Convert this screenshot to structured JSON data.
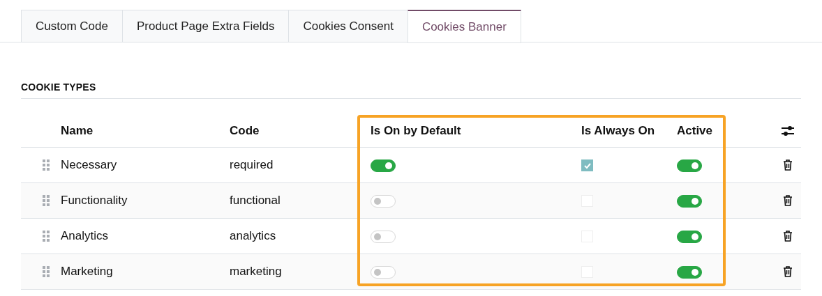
{
  "tabs": [
    {
      "label": "Custom Code",
      "selected": false
    },
    {
      "label": "Product Page Extra Fields",
      "selected": false
    },
    {
      "label": "Cookies Consent",
      "selected": false
    },
    {
      "label": "Cookies Banner",
      "selected": true
    }
  ],
  "section_title": "COOKIE TYPES",
  "table": {
    "columns": [
      "Name",
      "Code",
      "Is On by Default",
      "Is Always On",
      "Active"
    ],
    "rows": [
      {
        "name": "Necessary",
        "code": "required",
        "on_by_default": true,
        "always_on": true,
        "active": true
      },
      {
        "name": "Functionality",
        "code": "functional",
        "on_by_default": false,
        "always_on": false,
        "active": true
      },
      {
        "name": "Analytics",
        "code": "analytics",
        "on_by_default": false,
        "always_on": false,
        "active": true
      },
      {
        "name": "Marketing",
        "code": "marketing",
        "on_by_default": false,
        "always_on": false,
        "active": true
      }
    ]
  },
  "highlight_frame": true
}
